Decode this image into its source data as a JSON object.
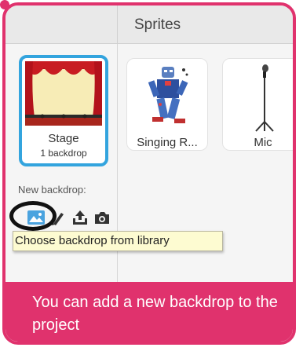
{
  "header": {
    "title": "Sprites"
  },
  "stage": {
    "label": "Stage",
    "sublabel": "1 backdrop"
  },
  "sprites": [
    {
      "name": "Singing R..."
    },
    {
      "name": "Mic"
    }
  ],
  "backdrop": {
    "new_label": "New backdrop:",
    "icons": [
      "backdrop-library-icon",
      "paint-icon",
      "upload-icon",
      "camera-icon"
    ],
    "tooltip": "Choose backdrop from library"
  },
  "banner": {
    "text": "You can add a new backdrop to the project"
  },
  "colors": {
    "accent": "#e0326d",
    "selection": "#33a4de",
    "tooltip_bg": "#fdfbd1"
  }
}
